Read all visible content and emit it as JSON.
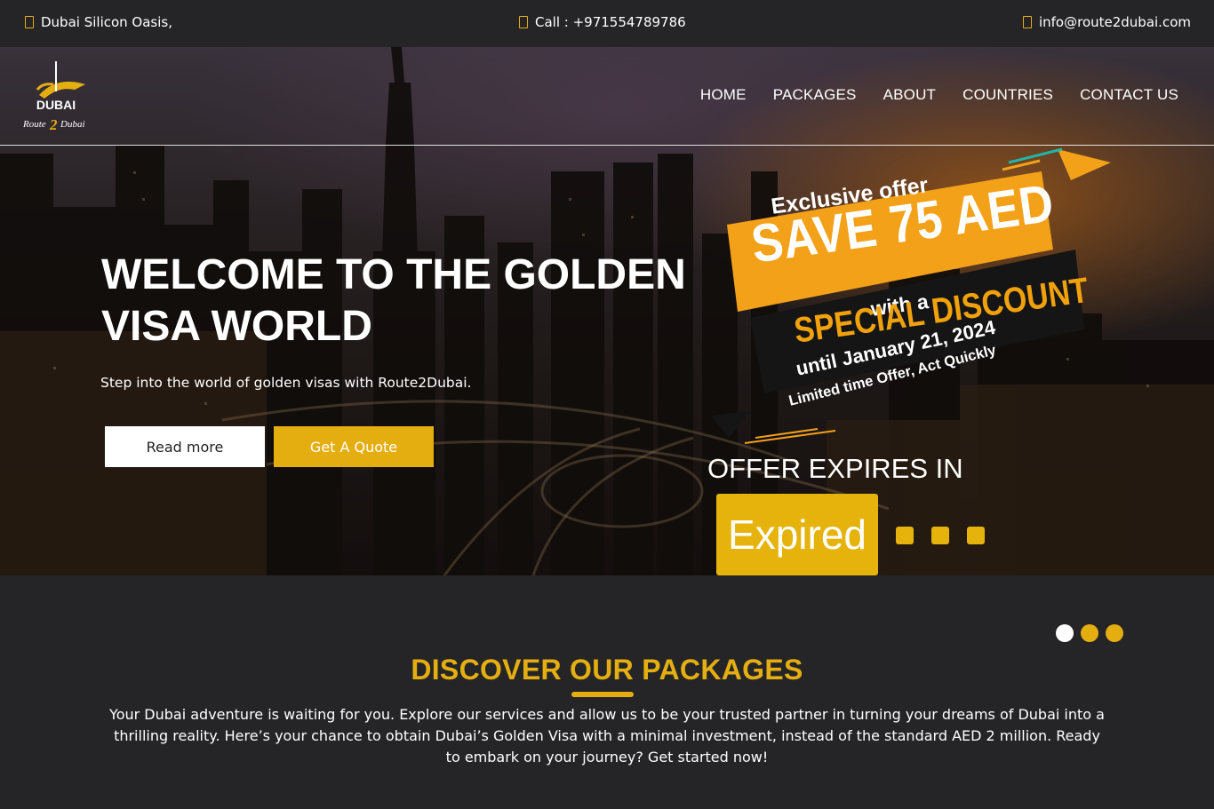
{
  "topbar": {
    "location": "Dubai Silicon Oasis,",
    "call": "Call : +971554789786",
    "email": "info@route2dubai.com"
  },
  "logo": {
    "word": "DUBAI",
    "brand_a": "Route",
    "brand_num": "2",
    "brand_b": "Dubai"
  },
  "nav": {
    "items": [
      "HOME",
      "PACKAGES",
      "ABOUT",
      "COUNTRIES",
      "CONTACT US"
    ]
  },
  "hero": {
    "title": "WELCOME TO THE GOLDEN VISA WORLD",
    "subtitle": "Step into the world of golden visas with Route2Dubai.",
    "read_more": "Read more",
    "get_quote": "Get A Quote"
  },
  "offer": {
    "exclusive": "Exclusive offer",
    "save": "SAVE 75 AED",
    "with_a": "with a",
    "special": "SPECIAL DISCOUNT",
    "until": "until January 21, 2024",
    "limited": "Limited time Offer, Act Quickly",
    "expires_title": "OFFER EXPIRES IN",
    "expired": "Expired"
  },
  "packages": {
    "title": "DISCOVER OUR PACKAGES",
    "text": "Your Dubai adventure is waiting for you. Explore our services and allow us to be your trusted partner in turning your dreams of Dubai into a thrilling reality. Here’s your chance to obtain Dubai’s Golden Visa with a minimal investment, instead of the standard AED 2 million. Ready to embark on your journey? Get started now!"
  },
  "colors": {
    "accent": "#e5ae10",
    "background": "#252527",
    "orange_badge": "#f4a11a"
  },
  "icons": {
    "location": "map-marker-icon",
    "call": "phone-icon",
    "email": "envelope-icon"
  }
}
